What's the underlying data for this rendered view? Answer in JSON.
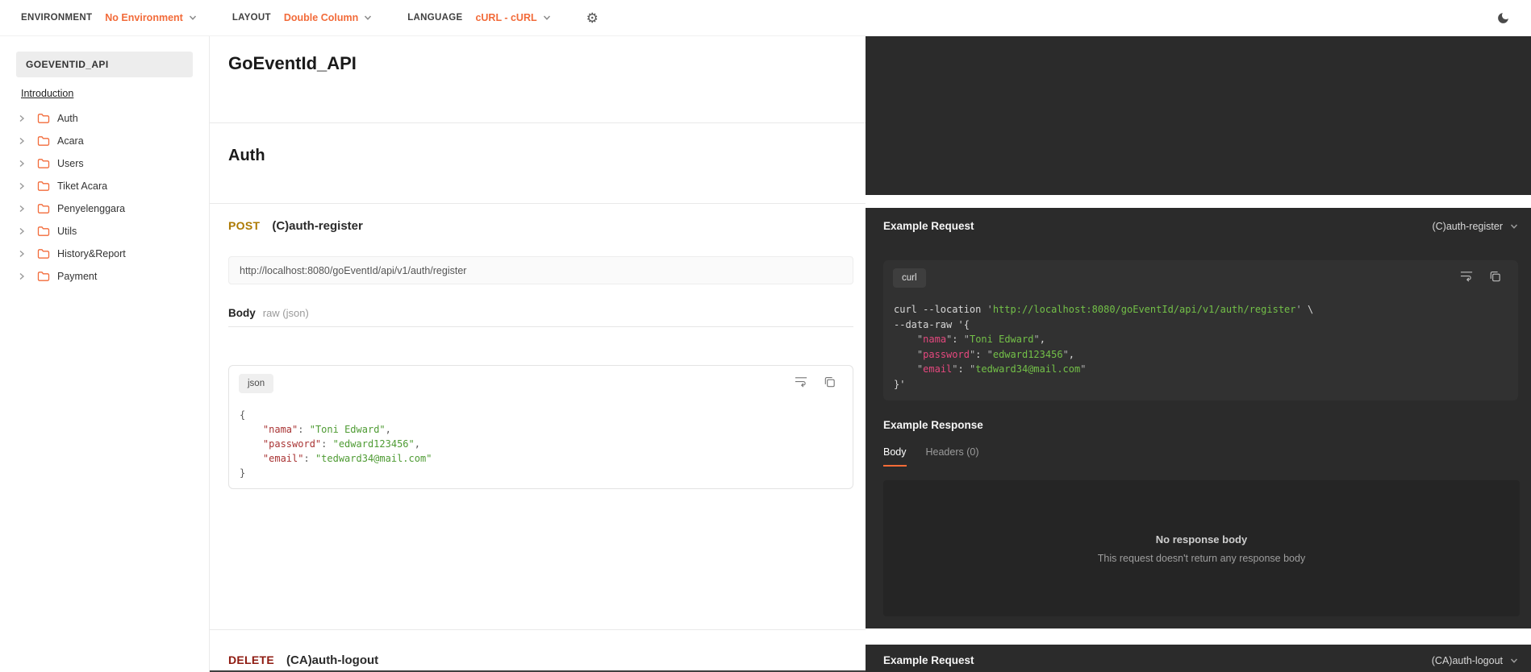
{
  "topbar": {
    "environment_label": "ENVIRONMENT",
    "environment_value": "No Environment",
    "layout_label": "LAYOUT",
    "layout_value": "Double Column",
    "language_label": "LANGUAGE",
    "language_value": "cURL - cURL",
    "gear_icon": "gear-icon",
    "theme_icon": "moon-icon"
  },
  "sidebar": {
    "collection": "GOEVENTID_API",
    "intro_link": "Introduction",
    "folders": [
      "Auth",
      "Acara",
      "Users",
      "Tiket Acara",
      "Penyelenggara",
      "Utils",
      "History&Report",
      "Payment"
    ]
  },
  "main": {
    "title": "GoEventId_API",
    "section": "Auth",
    "endpoint": {
      "method": "POST",
      "name": "(C)auth-register",
      "url": "http://localhost:8080/goEventId/api/v1/auth/register",
      "body_label": "Body",
      "body_mode": "raw (json)",
      "snippet_lang": "json",
      "code_lines": [
        [
          {
            "c": "t",
            "t": "{"
          }
        ],
        [
          {
            "c": "t",
            "t": "    "
          },
          {
            "c": "k",
            "t": "\"nama\""
          },
          {
            "c": "t",
            "t": ": "
          },
          {
            "c": "s",
            "t": "\"Toni Edward\""
          },
          {
            "c": "t",
            "t": ","
          }
        ],
        [
          {
            "c": "t",
            "t": "    "
          },
          {
            "c": "k",
            "t": "\"password\""
          },
          {
            "c": "t",
            "t": ": "
          },
          {
            "c": "s",
            "t": "\"edward123456\""
          },
          {
            "c": "t",
            "t": ","
          }
        ],
        [
          {
            "c": "t",
            "t": "    "
          },
          {
            "c": "k",
            "t": "\"email\""
          },
          {
            "c": "t",
            "t": ": "
          },
          {
            "c": "s",
            "t": "\"tedward34@mail.com\""
          }
        ],
        [
          {
            "c": "t",
            "t": "}"
          }
        ]
      ]
    },
    "next_endpoint": {
      "method": "DELETE",
      "name": "(CA)auth-logout"
    }
  },
  "request_example": {
    "title": "Example Request",
    "selected": "(C)auth-register",
    "snippet_lang": "curl",
    "code_lines": [
      [
        {
          "c": "t",
          "t": "curl --location "
        },
        {
          "c": "q",
          "t": "'"
        },
        {
          "c": "s",
          "t": "http://localhost:8080/goEventId/api/v1/auth/register"
        },
        {
          "c": "q",
          "t": "'"
        },
        {
          "c": "t",
          "t": " \\"
        }
      ],
      [
        {
          "c": "t",
          "t": "--data-raw '{"
        }
      ],
      [
        {
          "c": "t",
          "t": "    "
        },
        {
          "c": "q",
          "t": "\""
        },
        {
          "c": "k",
          "t": "nama"
        },
        {
          "c": "q",
          "t": "\""
        },
        {
          "c": "t",
          "t": ": "
        },
        {
          "c": "q",
          "t": "\""
        },
        {
          "c": "s",
          "t": "Toni Edward"
        },
        {
          "c": "q",
          "t": "\""
        },
        {
          "c": "t",
          "t": ","
        }
      ],
      [
        {
          "c": "t",
          "t": "    "
        },
        {
          "c": "q",
          "t": "\""
        },
        {
          "c": "k",
          "t": "password"
        },
        {
          "c": "q",
          "t": "\""
        },
        {
          "c": "t",
          "t": ": "
        },
        {
          "c": "q",
          "t": "\""
        },
        {
          "c": "s",
          "t": "edward123456"
        },
        {
          "c": "q",
          "t": "\""
        },
        {
          "c": "t",
          "t": ","
        }
      ],
      [
        {
          "c": "t",
          "t": "    "
        },
        {
          "c": "q",
          "t": "\""
        },
        {
          "c": "k",
          "t": "email"
        },
        {
          "c": "q",
          "t": "\""
        },
        {
          "c": "t",
          "t": ": "
        },
        {
          "c": "q",
          "t": "\""
        },
        {
          "c": "s",
          "t": "tedward34@mail.com"
        },
        {
          "c": "q",
          "t": "\""
        }
      ],
      [
        {
          "c": "t",
          "t": "}'"
        }
      ]
    ]
  },
  "response_example": {
    "title": "Example Response",
    "tab_body": "Body",
    "tab_headers": "Headers (0)",
    "empty_title": "No response body",
    "empty_message": "This request doesn't return any response body"
  },
  "request_example_2": {
    "title": "Example Request",
    "selected": "(CA)auth-logout"
  },
  "colors": {
    "accent_orange": "#f26b3a",
    "active_tab_underline": "#ff6c37",
    "method_post": "#ad7a03",
    "method_delete": "#8e1a10",
    "dark_panel": "#2b2b2b",
    "dark_snippet": "#313131",
    "json_key_light": "#a93434",
    "json_value_light": "#4e9b33",
    "json_key_dark": "#e5487e",
    "json_value_dark": "#73c048"
  }
}
